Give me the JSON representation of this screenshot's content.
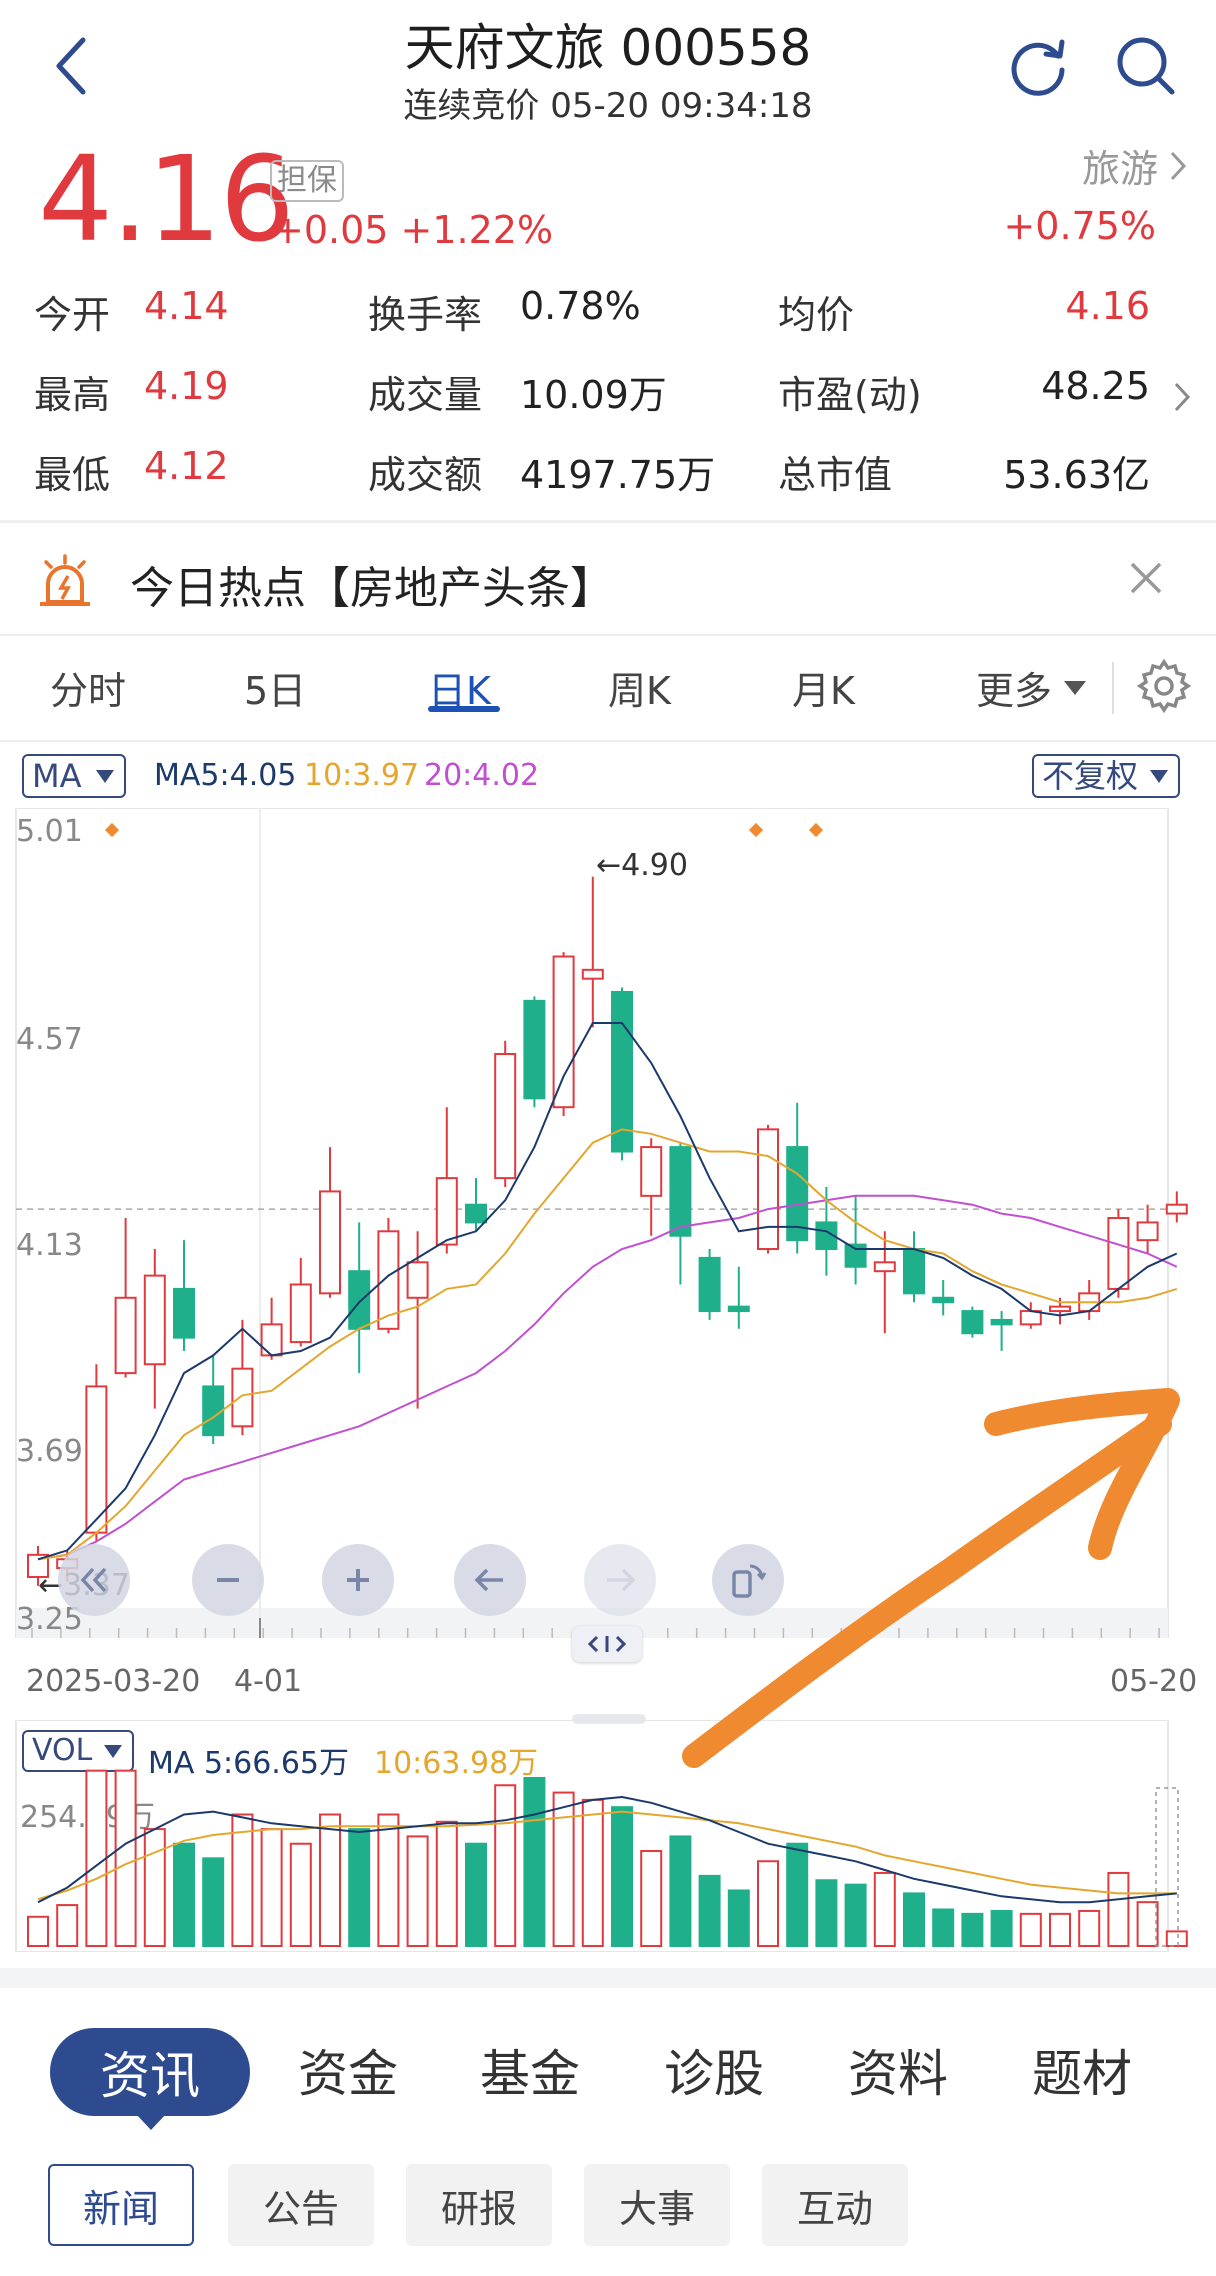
{
  "header": {
    "title": "天府文旅 000558",
    "subtitle": "连续竞价 05-20 09:34:18"
  },
  "quote": {
    "price": "4.16",
    "tag": "担保",
    "change": "+0.05 +1.22%",
    "sector": "旅游",
    "sector_change": "+0.75%"
  },
  "stats": {
    "open_label": "今开",
    "open_value": "4.14",
    "high_label": "最高",
    "high_value": "4.19",
    "low_label": "最低",
    "low_value": "4.12",
    "turnover_label": "换手率",
    "turnover_value": "0.78%",
    "volume_label": "成交量",
    "volume_value": "10.09万",
    "amount_label": "成交额",
    "amount_value": "4197.75万",
    "avg_label": "均价",
    "avg_value": "4.16",
    "pe_label": "市盈(动)",
    "pe_value": "48.25",
    "mktcap_label": "总市值",
    "mktcap_value": "53.63亿"
  },
  "hot": {
    "text": "今日热点【房地产头条】"
  },
  "tabs": [
    "分时",
    "5日",
    "日K",
    "周K",
    "月K",
    "更多"
  ],
  "active_tab": "日K",
  "chart": {
    "ma_selector": "MA",
    "ma5_text": "MA5:4.05",
    "ma10_text": "10:3.97",
    "ma20_text": "20:4.02",
    "adjust_selector": "不复权",
    "y_ticks": [
      "5.01",
      "4.57",
      "4.13",
      "3.69",
      "3.25"
    ],
    "high_mark": "←4.90",
    "low_mark": "←3.37",
    "x_start": "2025-03-20",
    "x_mid": "4-01",
    "x_end": "05-20",
    "vol_selector": "VOL",
    "vol_ma5_text": "MA 5:66.65万",
    "vol_ma10_text": "10:63.98万",
    "vol_max": "254.59万"
  },
  "colors": {
    "up": "#e0393e",
    "down": "#1fb08b",
    "ma5": "#1b3a6b",
    "ma10": "#e3a72f",
    "ma20": "#c050d0",
    "accent": "#1d52b4",
    "annotation": "#f08a30"
  },
  "chart_data": {
    "type": "candlestick",
    "ylim": [
      3.25,
      5.01
    ],
    "candles": [
      {
        "o": 3.32,
        "c": 3.37,
        "h": 3.39,
        "l": 3.3,
        "v": 20
      },
      {
        "o": 3.34,
        "c": 3.36,
        "h": 3.38,
        "l": 3.31,
        "v": 28
      },
      {
        "o": 3.42,
        "c": 3.75,
        "h": 3.8,
        "l": 3.4,
        "v": 120
      },
      {
        "o": 3.78,
        "c": 3.95,
        "h": 4.13,
        "l": 3.77,
        "v": 120
      },
      {
        "o": 3.8,
        "c": 4.0,
        "h": 4.06,
        "l": 3.7,
        "v": 80
      },
      {
        "o": 3.97,
        "c": 3.86,
        "h": 4.08,
        "l": 3.83,
        "v": 70
      },
      {
        "o": 3.75,
        "c": 3.64,
        "h": 3.82,
        "l": 3.62,
        "v": 60
      },
      {
        "o": 3.66,
        "c": 3.79,
        "h": 3.9,
        "l": 3.64,
        "v": 90
      },
      {
        "o": 3.82,
        "c": 3.89,
        "h": 3.95,
        "l": 3.81,
        "v": 80
      },
      {
        "o": 3.85,
        "c": 3.98,
        "h": 4.04,
        "l": 3.84,
        "v": 70
      },
      {
        "o": 3.96,
        "c": 4.19,
        "h": 4.29,
        "l": 3.95,
        "v": 90
      },
      {
        "o": 4.01,
        "c": 3.88,
        "h": 4.12,
        "l": 3.78,
        "v": 80
      },
      {
        "o": 3.88,
        "c": 4.1,
        "h": 4.13,
        "l": 3.87,
        "v": 90
      },
      {
        "o": 3.95,
        "c": 4.03,
        "h": 4.1,
        "l": 3.7,
        "v": 75
      },
      {
        "o": 4.07,
        "c": 4.22,
        "h": 4.38,
        "l": 4.05,
        "v": 85
      },
      {
        "o": 4.16,
        "c": 4.12,
        "h": 4.22,
        "l": 4.1,
        "v": 70
      },
      {
        "o": 4.22,
        "c": 4.5,
        "h": 4.53,
        "l": 4.2,
        "v": 110
      },
      {
        "o": 4.62,
        "c": 4.4,
        "h": 4.63,
        "l": 4.38,
        "v": 115
      },
      {
        "o": 4.38,
        "c": 4.72,
        "h": 4.73,
        "l": 4.36,
        "v": 105
      },
      {
        "o": 4.67,
        "c": 4.69,
        "h": 4.9,
        "l": 4.56,
        "v": 100
      },
      {
        "o": 4.64,
        "c": 4.28,
        "h": 4.65,
        "l": 4.26,
        "v": 95
      },
      {
        "o": 4.18,
        "c": 4.29,
        "h": 4.31,
        "l": 4.09,
        "v": 65
      },
      {
        "o": 4.29,
        "c": 4.09,
        "h": 4.3,
        "l": 3.98,
        "v": 75
      },
      {
        "o": 4.04,
        "c": 3.92,
        "h": 4.06,
        "l": 3.9,
        "v": 48
      },
      {
        "o": 3.93,
        "c": 3.92,
        "h": 4.02,
        "l": 3.88,
        "v": 38
      },
      {
        "o": 4.06,
        "c": 4.33,
        "h": 4.34,
        "l": 4.05,
        "v": 58
      },
      {
        "o": 4.29,
        "c": 4.08,
        "h": 4.39,
        "l": 4.05,
        "v": 70
      },
      {
        "o": 4.12,
        "c": 4.06,
        "h": 4.2,
        "l": 4.0,
        "v": 45
      },
      {
        "o": 4.07,
        "c": 4.02,
        "h": 4.18,
        "l": 3.98,
        "v": 42
      },
      {
        "o": 4.01,
        "c": 4.03,
        "h": 4.1,
        "l": 3.87,
        "v": 50
      },
      {
        "o": 4.06,
        "c": 3.96,
        "h": 4.1,
        "l": 3.94,
        "v": 36
      },
      {
        "o": 3.95,
        "c": 3.94,
        "h": 3.99,
        "l": 3.91,
        "v": 25
      },
      {
        "o": 3.92,
        "c": 3.87,
        "h": 3.93,
        "l": 3.86,
        "v": 22
      },
      {
        "o": 3.9,
        "c": 3.89,
        "h": 3.92,
        "l": 3.83,
        "v": 24
      },
      {
        "o": 3.89,
        "c": 3.92,
        "h": 3.94,
        "l": 3.88,
        "v": 22
      },
      {
        "o": 3.92,
        "c": 3.93,
        "h": 3.95,
        "l": 3.89,
        "v": 22
      },
      {
        "o": 3.92,
        "c": 3.96,
        "h": 3.99,
        "l": 3.9,
        "v": 24
      },
      {
        "o": 3.97,
        "c": 4.13,
        "h": 4.15,
        "l": 3.95,
        "v": 50
      },
      {
        "o": 4.08,
        "c": 4.12,
        "h": 4.16,
        "l": 4.05,
        "v": 30
      },
      {
        "o": 4.14,
        "c": 4.16,
        "h": 4.19,
        "l": 4.12,
        "v": 10
      }
    ],
    "ma5": [
      3.36,
      3.38,
      3.45,
      3.52,
      3.64,
      3.78,
      3.82,
      3.88,
      3.82,
      3.83,
      3.86,
      3.94,
      4.0,
      4.04,
      4.08,
      4.1,
      4.17,
      4.29,
      4.45,
      4.57,
      4.57,
      4.48,
      4.36,
      4.22,
      4.1,
      4.11,
      4.11,
      4.1,
      4.06,
      4.06,
      4.06,
      4.04,
      4.0,
      3.97,
      3.92,
      3.91,
      3.92,
      3.97,
      4.02,
      4.05
    ],
    "ma10": [
      3.36,
      3.37,
      3.42,
      3.48,
      3.56,
      3.64,
      3.68,
      3.73,
      3.74,
      3.79,
      3.84,
      3.88,
      3.91,
      3.93,
      3.97,
      3.98,
      4.05,
      4.14,
      4.22,
      4.3,
      4.33,
      4.32,
      4.3,
      4.28,
      4.28,
      4.27,
      4.23,
      4.17,
      4.12,
      4.08,
      4.06,
      4.05,
      4.01,
      3.98,
      3.96,
      3.94,
      3.94,
      3.94,
      3.95,
      3.97
    ],
    "ma20": [
      3.36,
      3.37,
      3.4,
      3.44,
      3.49,
      3.54,
      3.56,
      3.58,
      3.6,
      3.62,
      3.64,
      3.66,
      3.69,
      3.72,
      3.75,
      3.78,
      3.83,
      3.89,
      3.96,
      4.02,
      4.06,
      4.08,
      4.11,
      4.12,
      4.13,
      4.15,
      4.16,
      4.17,
      4.18,
      4.18,
      4.18,
      4.17,
      4.16,
      4.14,
      4.13,
      4.11,
      4.09,
      4.07,
      4.05,
      4.02
    ],
    "vol_ma5": [
      30,
      40,
      55,
      70,
      80,
      90,
      92,
      88,
      84,
      82,
      80,
      78,
      80,
      82,
      84,
      84,
      86,
      90,
      95,
      100,
      102,
      98,
      92,
      86,
      78,
      70,
      66,
      62,
      58,
      52,
      46,
      42,
      38,
      34,
      32,
      30,
      30,
      32,
      34,
      36
    ],
    "vol_ma10": [
      32,
      38,
      46,
      56,
      64,
      72,
      76,
      78,
      80,
      80,
      82,
      82,
      82,
      82,
      82,
      83,
      84,
      86,
      88,
      90,
      92,
      90,
      88,
      86,
      84,
      80,
      76,
      72,
      68,
      62,
      58,
      54,
      50,
      46,
      42,
      40,
      38,
      36,
      36,
      36
    ]
  }
}
